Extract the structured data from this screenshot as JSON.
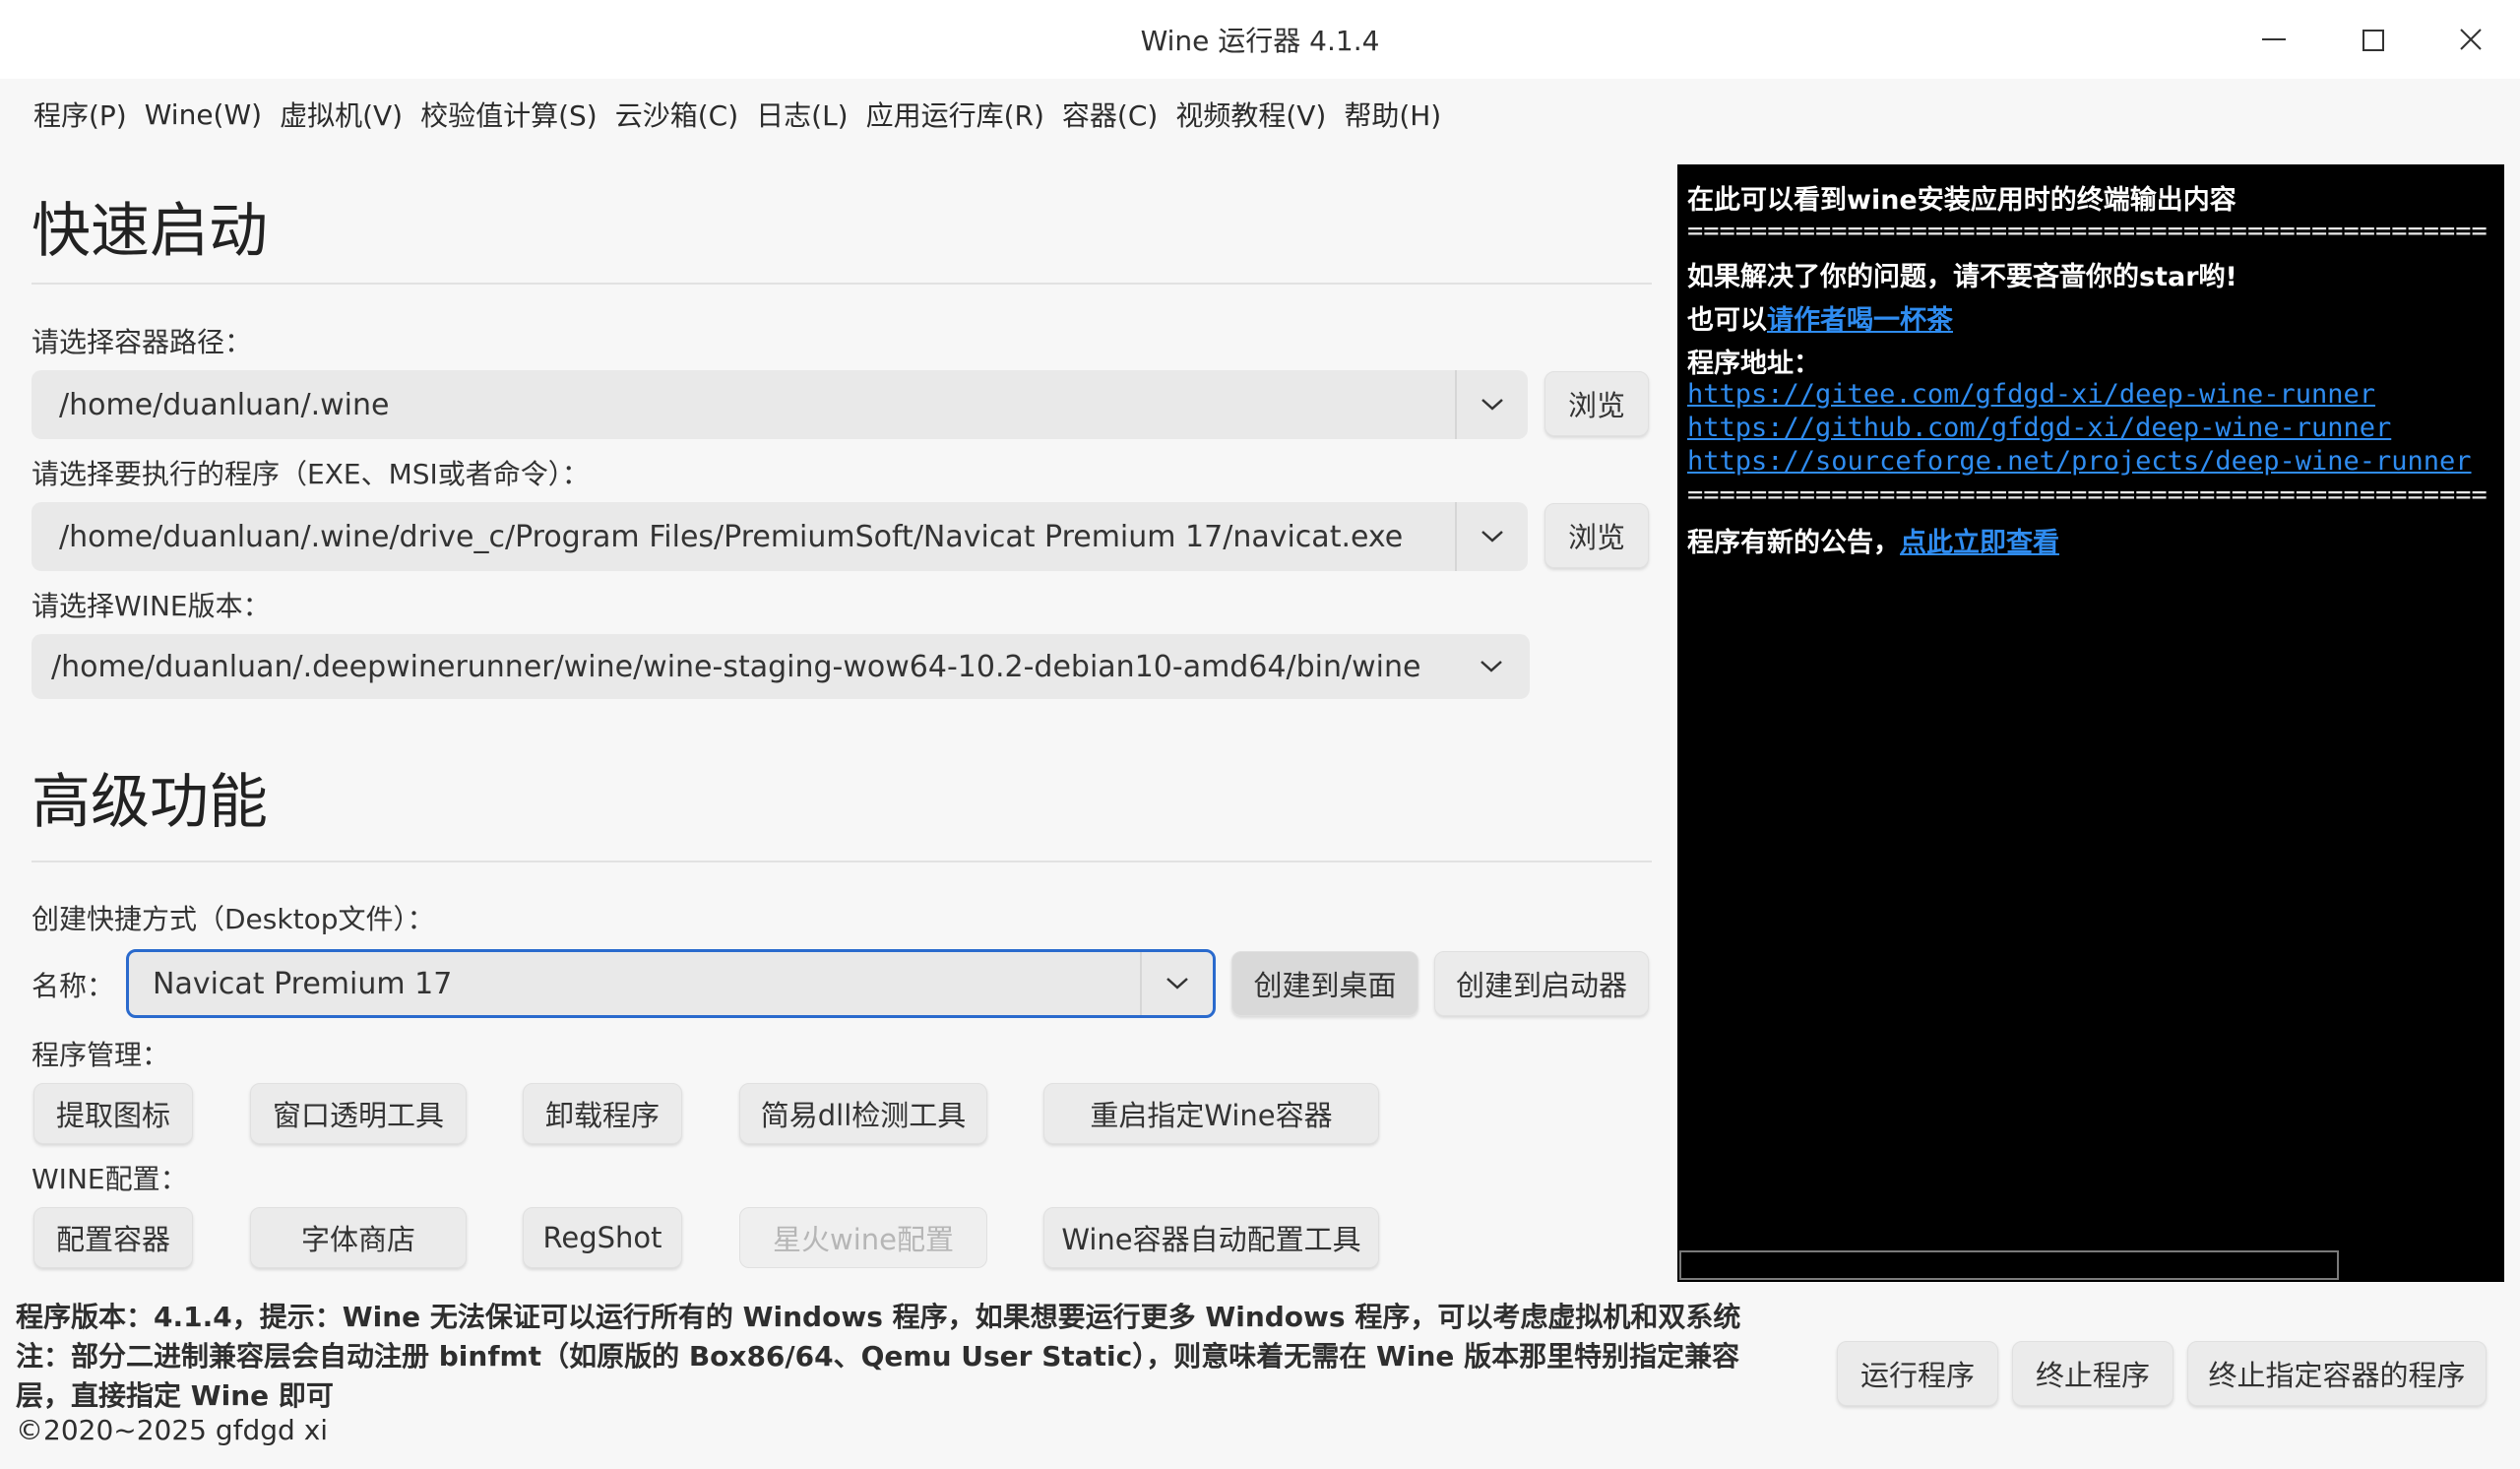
{
  "window": {
    "title": "Wine 运行器 4.1.4"
  },
  "menubar": {
    "items": [
      "程序(P)",
      "Wine(W)",
      "虚拟机(V)",
      "校验值计算(S)",
      "云沙箱(C)",
      "日志(L)",
      "应用运行库(R)",
      "容器(C)",
      "视频教程(V)",
      "帮助(H)"
    ]
  },
  "quick_start": {
    "heading": "快速启动",
    "container_label": "请选择容器路径：",
    "container_value": "/home/duanluan/.wine",
    "browse_label": "浏览",
    "program_label": "请选择要执行的程序（EXE、MSI或者命令）：",
    "program_value": "/home/duanluan/.wine/drive_c/Program Files/PremiumSoft/Navicat Premium 17/navicat.exe",
    "wine_label": "请选择WINE版本：",
    "wine_value": "/home/duanluan/.deepwinerunner/wine/wine-staging-wow64-10.2-debian10-amd64/bin/wine"
  },
  "advanced": {
    "heading": "高级功能",
    "shortcut_label": "创建快捷方式（Desktop文件）：",
    "name_label": "名称：",
    "name_value": "Navicat Premium 17",
    "create_desktop": "创建到桌面",
    "create_launcher": "创建到启动器",
    "program_mgmt_label": "程序管理：",
    "program_mgmt_buttons": [
      "提取图标",
      "窗口透明工具",
      "卸载程序",
      "简易dll检测工具",
      "重启指定Wine容器"
    ],
    "wine_config_label": "WINE配置：",
    "wine_config_buttons": [
      "配置容器",
      "字体商店",
      "RegShot",
      "星火wine配置",
      "Wine容器自动配置工具"
    ]
  },
  "terminal": {
    "line1": "在此可以看到wine安装应用时的终端输出内容",
    "separator": "==================================================",
    "star_text": "如果解决了你的问题，请不要吝啬你的star哟!",
    "tea_prefix": "也可以",
    "tea_link": "请作者喝一杯茶",
    "address_label": "程序地址：",
    "links": [
      "https://gitee.com/gfdgd-xi/deep-wine-runner",
      "https://github.com/gfdgd-xi/deep-wine-runner",
      "https://sourceforge.net/projects/deep-wine-runner"
    ],
    "notice_prefix": "程序有新的公告，",
    "notice_link": "点此立即查看"
  },
  "footer": {
    "line1": "程序版本：4.1.4，提示：Wine 无法保证可以运行所有的 Windows 程序，如果想要运行更多 Windows 程序，可以考虑虚拟机和双系统",
    "line2": "注：部分二进制兼容层会自动注册 binfmt（如原版的 Box86/64、Qemu User Static），则意味着无需在 Wine 版本那里特别指定兼容",
    "line3": "层，直接指定 Wine 即可",
    "copyright": "©2020~2025 gfdgd xi",
    "run_button": "运行程序",
    "stop_button": "终止程序",
    "stop_container_button": "终止指定容器的程序"
  },
  "colors": {
    "accent": "#2a6acd",
    "link": "#2f8cf0",
    "terminal_bg": "#000000"
  }
}
